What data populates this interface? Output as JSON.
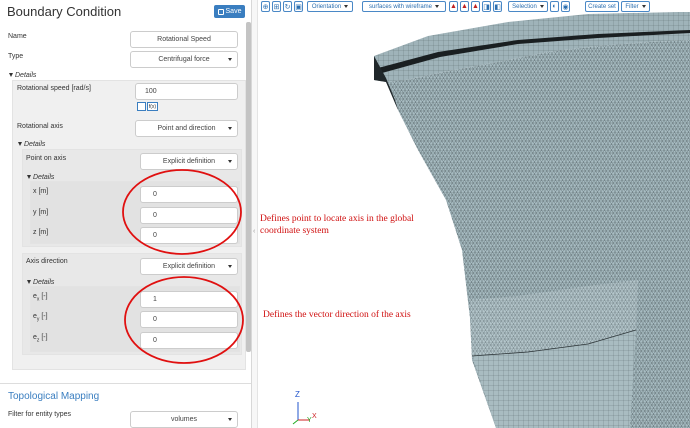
{
  "panel": {
    "title": "Boundary Condition",
    "save_label": "Save",
    "name_label": "Name",
    "name_value": "Rotational Speed",
    "type_label": "Type",
    "type_value": "Centrifugal force",
    "details_label": "Details",
    "rot_speed_label": "Rotational speed [rad/s]",
    "rot_speed_value": "100",
    "fx_label": "f(x)",
    "rot_axis_label": "Rotational axis",
    "rot_axis_value": "Point and direction",
    "point_on_axis_label": "Point on axis",
    "point_on_axis_value": "Explicit definition",
    "x_label": "x [m]",
    "x_value": "0",
    "y_label": "y [m]",
    "y_value": "0",
    "z_label": "z [m]",
    "z_value": "0",
    "axis_dir_label": "Axis direction",
    "axis_dir_value": "Explicit definition",
    "ex_label": "e",
    "ex_sub": "x",
    "ex_unit": " [-]",
    "ex_value": "1",
    "ey_label": "e",
    "ey_sub": "y",
    "ey_unit": " [-]",
    "ey_value": "0",
    "ez_label": "e",
    "ez_sub": "z",
    "ez_unit": " [-]",
    "ez_value": "0",
    "topo_label": "Topological Mapping",
    "filter_label": "Filter for entity types",
    "filter_value": "volumes"
  },
  "toolbar": {
    "orientation": "Orientation",
    "render_mode": "surfaces with wireframe",
    "selection": "Selection",
    "create_set": "Create set",
    "filter": "Filter"
  },
  "annotations": {
    "point_note_line1": "Defines point to locate axis in the global",
    "point_note_line2": "coordinate system",
    "direction_note": "Defines the vector direction of the axis"
  },
  "triad": {
    "z": "Z",
    "x": "X",
    "y": "Y"
  },
  "colors": {
    "accent": "#3a7ec0",
    "mesh_fill": "#a8bcc2",
    "annotation": "#d01010"
  }
}
